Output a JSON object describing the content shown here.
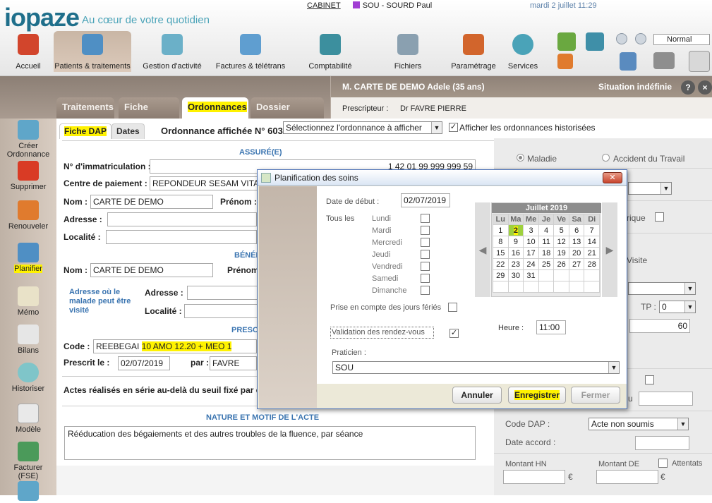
{
  "app": {
    "logo": "iopaze",
    "tagline": "Au cœur de votre quotidien",
    "cabinet_link": "CABINET",
    "user": "SOU - SOURD Paul",
    "datetime": "mardi 2 juillet 11:29",
    "zoom": "Normal"
  },
  "nav": {
    "items": [
      {
        "label": "Accueil",
        "icon": "house-icon"
      },
      {
        "label": "Patients & traitements",
        "icon": "patients-icon"
      },
      {
        "label": "Gestion d'activité",
        "icon": "activity-icon"
      },
      {
        "label": "Factures & télétrans",
        "icon": "invoices-icon"
      },
      {
        "label": "Comptabilité",
        "icon": "calculator-icon"
      },
      {
        "label": "Fichiers",
        "icon": "database-icon"
      },
      {
        "label": "Paramétrage",
        "icon": "gears-icon"
      },
      {
        "label": "Services",
        "icon": "globe-icon"
      }
    ]
  },
  "tabs": [
    "Traitements",
    "Fiche patient",
    "Ordonnances",
    "Dossier médical"
  ],
  "patient": {
    "name": "M. CARTE DE DEMO Adele (35 ans)",
    "situation": "Situation indéfinie",
    "prescriber_label": "Prescripteur :",
    "prescriber": "Dr FAVRE PIERRE"
  },
  "sidebar": {
    "items": [
      "Créer Ordonnance",
      "Supprimer",
      "Renouveler",
      "Planifier",
      "Mémo",
      "Bilans",
      "Historiser",
      "Modèle",
      "Facturer (FSE)"
    ]
  },
  "subtabs": [
    "Fiche DAP",
    "Dates"
  ],
  "ordonnance": {
    "title": "Ordonnance affichée N° 603",
    "select": "Sélectionnez l'ordonnance à afficher",
    "show_history": "Afficher les ordonnances historisées",
    "assure_section": "ASSURÉ(E)",
    "immat_label": "N° d'immatriculation :",
    "immat": "1 42 01 99 999 999 59",
    "centre_label": "Centre de paiement :",
    "centre": "REPONDEUR SESAM VITA",
    "nom_label": "Nom :",
    "nom": "CARTE DE DEMO",
    "prenom_label": "Prénom :",
    "adresse_label": "Adresse :",
    "localite_label": "Localité :",
    "benef_section": "BÉNÉF",
    "benef_nom": "CARTE DE DEMO",
    "benef_prenom_label": "Prénom",
    "visit_address_label": "Adresse où le malade peut être visité",
    "presc_section": "PRESC",
    "code_label": "Code :",
    "code": "REEBEGAI",
    "code_hl": "10 AMO 12.20 + MEO 1",
    "prescrit_label": "Prescrit le :",
    "prescrit_date": "02/07/2019",
    "par_label": "par :",
    "par": "FAVRE",
    "series_text": "Actes réalisés en série au-delà du seuil fixé par d",
    "nature_section": "NATURE ET MOTIF DE L'ACTE",
    "nature": "Rééducation des bégaiements et des autres troubles de la fluence, par séance"
  },
  "right": {
    "maladie": "Maladie",
    "accident": "Accident du Travail",
    "rique": "rique",
    "visite": "Visite",
    "tp_label": "TP :",
    "tp": "0",
    "amount": "60",
    "u": "u",
    "code_dap_label": "Code DAP :",
    "code_dap": "Acte non soumis",
    "date_accord_label": "Date accord :",
    "montant_hn": "Montant HN",
    "montant_de": "Montant DE",
    "attentats": "Attentats",
    "euro": "€"
  },
  "modal": {
    "title": "Planification des soins",
    "date_label": "Date de début :",
    "date": "02/07/2019",
    "tous_les": "Tous les",
    "days": [
      "Lundi",
      "Mardi",
      "Mercredi",
      "Jeudi",
      "Vendredi",
      "Samedi",
      "Dimanche"
    ],
    "feries": "Prise en compte des jours fériés",
    "validation": "Validation des rendez-vous",
    "heure_label": "Heure :",
    "heure": "11:00",
    "praticien_label": "Praticien :",
    "praticien": "SOU",
    "buttons": {
      "cancel": "Annuler",
      "save": "Enregistrer",
      "close": "Fermer"
    }
  },
  "calendar": {
    "title": "Juillet 2019",
    "weekdays": [
      "Lu",
      "Ma",
      "Me",
      "Je",
      "Ve",
      "Sa",
      "Di"
    ],
    "weeks": [
      [
        "1",
        "2",
        "3",
        "4",
        "5",
        "6",
        "7"
      ],
      [
        "8",
        "9",
        "10",
        "11",
        "12",
        "13",
        "14"
      ],
      [
        "15",
        "16",
        "17",
        "18",
        "19",
        "20",
        "21"
      ],
      [
        "22",
        "23",
        "24",
        "25",
        "26",
        "27",
        "28"
      ],
      [
        "29",
        "30",
        "31",
        "",
        "",
        "",
        ""
      ],
      [
        "",
        "",
        "",
        "",
        "",
        "",
        ""
      ]
    ],
    "today": "2"
  },
  "colors": {
    "brand": "#1f6f8b",
    "accent": "#6db33f",
    "highlight": "#fff200",
    "section": "#3a74b0"
  }
}
